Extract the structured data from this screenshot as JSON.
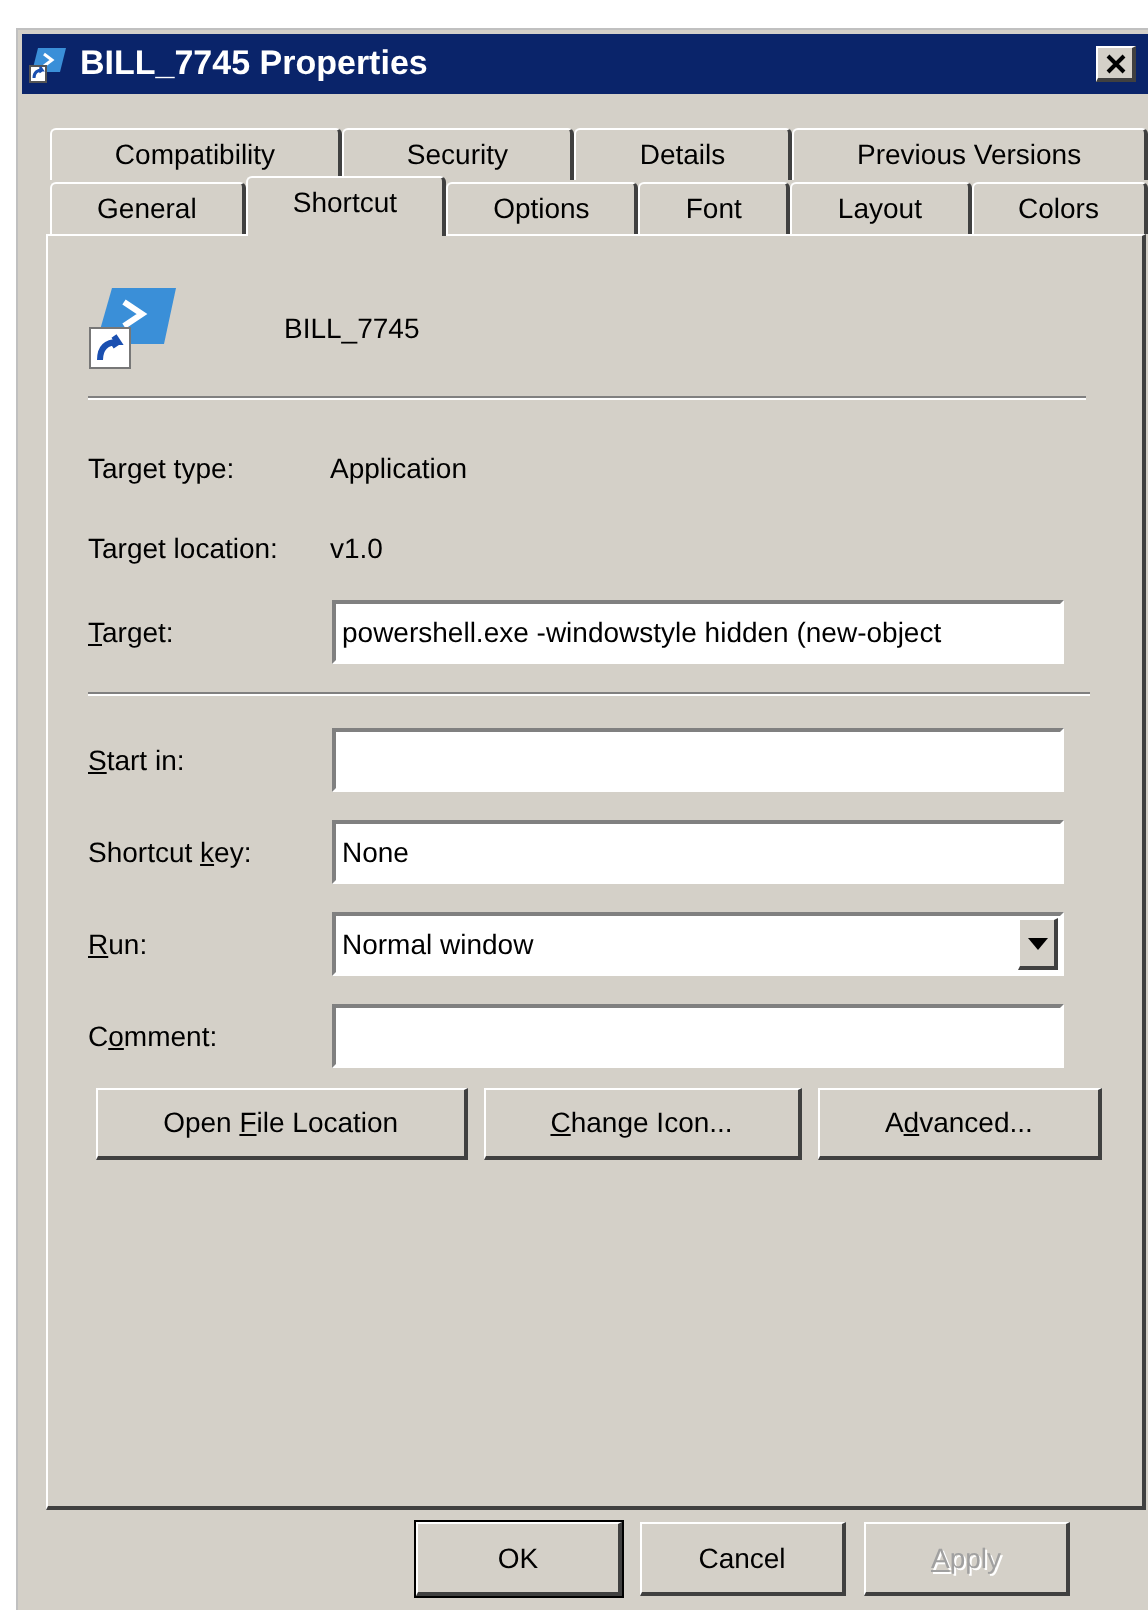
{
  "window": {
    "title": "BILL_7745 Properties"
  },
  "tab_rows": [
    [
      {
        "label": "Compatibility",
        "selected": false
      },
      {
        "label": "Security",
        "selected": false
      },
      {
        "label": "Details",
        "selected": false
      },
      {
        "label": "Previous Versions",
        "selected": false
      }
    ],
    [
      {
        "label": "General",
        "selected": false
      },
      {
        "label": "Shortcut",
        "selected": true
      },
      {
        "label": "Options",
        "selected": false
      },
      {
        "label": "Font",
        "selected": false
      },
      {
        "label": "Layout",
        "selected": false
      },
      {
        "label": "Colors",
        "selected": false
      }
    ]
  ],
  "shortcut_name": "BILL_7745",
  "info": [
    {
      "label": "Target type:",
      "value": "Application"
    },
    {
      "label": "Target location:",
      "value": "v1.0"
    }
  ],
  "target": {
    "label": {
      "key": "T",
      "after": "arget:"
    },
    "value": "powershell.exe -windowstyle hidden (new-object"
  },
  "fields": [
    {
      "kind": "text",
      "label": {
        "key": "S",
        "after": "tart in:"
      }
    },
    {
      "kind": "text",
      "label": {
        "before": "Shortcut ",
        "key": "k",
        "after": "ey:"
      },
      "value": "None"
    },
    {
      "kind": "dropdown",
      "label": {
        "key": "R",
        "after": "un:"
      },
      "value": "Normal window"
    },
    {
      "kind": "text",
      "label": {
        "before": "C",
        "key": "o",
        "after": "mment:"
      }
    }
  ],
  "action_buttons": [
    {
      "label": {
        "before": "Open ",
        "key": "F",
        "after": "ile Location"
      }
    },
    {
      "label": {
        "key": "C",
        "after": "hange Icon..."
      }
    },
    {
      "label": {
        "before": "A",
        "key": "d",
        "after": "vanced..."
      }
    }
  ],
  "dialog_buttons": [
    {
      "label": {
        "after": "OK"
      },
      "default": true,
      "disabled": false
    },
    {
      "label": {
        "after": "Cancel"
      },
      "default": false,
      "disabled": false
    },
    {
      "label": {
        "key": "A",
        "after": "pply"
      },
      "default": false,
      "disabled": true
    }
  ]
}
